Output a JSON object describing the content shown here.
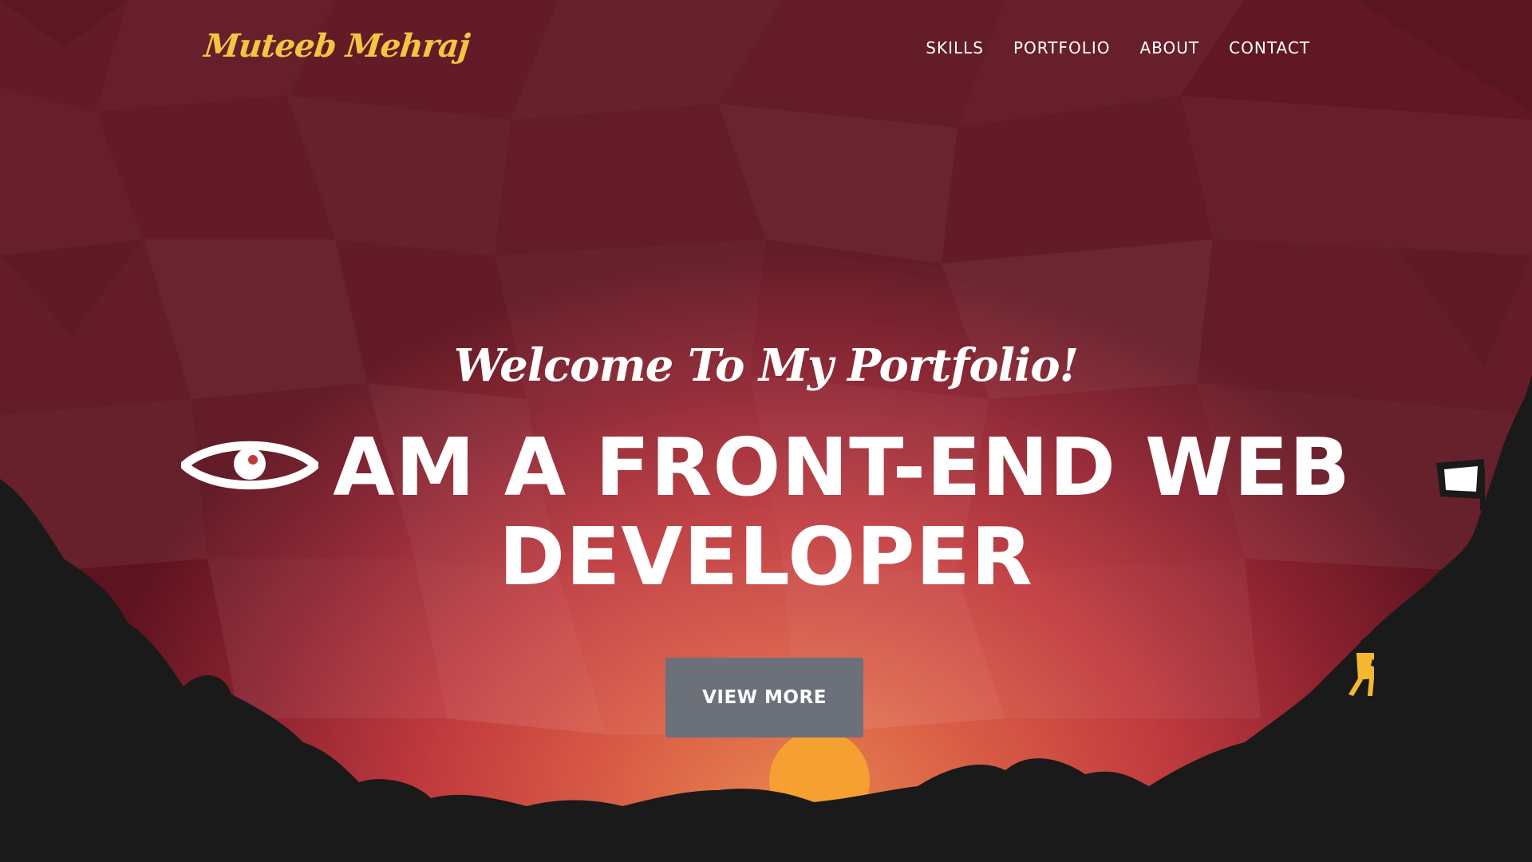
{
  "header": {
    "logo": "Muteeb Mehraj",
    "nav": [
      "SKILLS",
      "PORTFOLIO",
      "ABOUT",
      "CONTACT"
    ]
  },
  "hero": {
    "welcome": "Welcome To My Portfolio!",
    "headline_line1": "AM A FRONT-END WEB",
    "headline_line2": "DEVELOPER",
    "leading_icon": "eye-icon",
    "cta": "VIEW MORE"
  },
  "colors": {
    "logo": "#f5c542",
    "sky_center": "#e98650",
    "sky_edge": "#5e1420",
    "silhouette": "#1a1a1a",
    "sun": "#f5a030",
    "button": "#6b7079"
  }
}
